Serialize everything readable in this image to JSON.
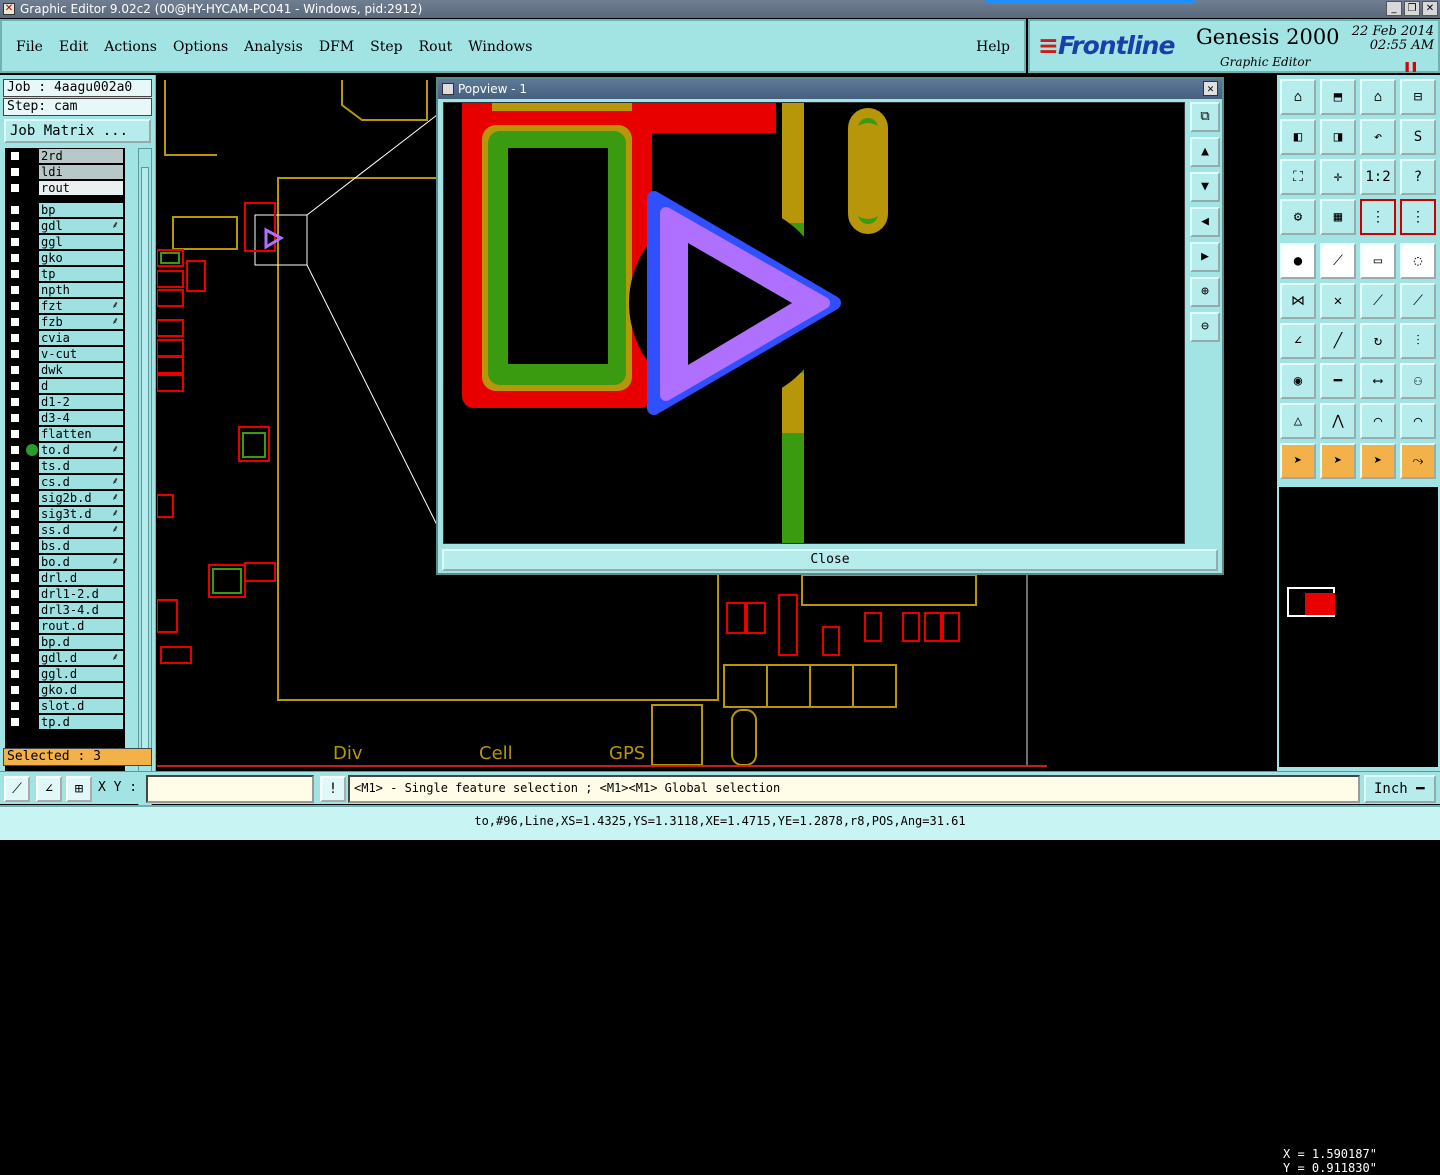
{
  "window": {
    "title": "Graphic Editor 9.02c2 (00@HY-HYCAM-PC041 - Windows, pid:2912)",
    "minimize": "_",
    "maximize": "❐",
    "close": "✕"
  },
  "menu": {
    "items": [
      "File",
      "Edit",
      "Actions",
      "Options",
      "Analysis",
      "DFM",
      "Step",
      "Rout",
      "Windows"
    ],
    "help": "Help"
  },
  "brand": {
    "logo": "Frontline",
    "product": "Genesis 2000",
    "subtitle": "Graphic Editor",
    "date": "22 Feb 2014",
    "time": "02:55 AM"
  },
  "left": {
    "job": "Job : 4aagu002a0",
    "step": "Step: cam",
    "job_matrix": "Job Matrix ...",
    "selected": "Selected : 3",
    "layers": [
      {
        "name": "2rd",
        "style": "gray"
      },
      {
        "name": "ldi",
        "style": "gray"
      },
      {
        "name": "rout",
        "style": "light"
      },
      {
        "name": "bp"
      },
      {
        "name": "gdl",
        "mark": true
      },
      {
        "name": "ggl"
      },
      {
        "name": "gko"
      },
      {
        "name": "tp"
      },
      {
        "name": "npth"
      },
      {
        "name": "fzt",
        "mark": true
      },
      {
        "name": "fzb",
        "mark": true
      },
      {
        "name": "cvia"
      },
      {
        "name": "v-cut"
      },
      {
        "name": "dwk"
      },
      {
        "name": "d"
      },
      {
        "name": "d1-2"
      },
      {
        "name": "d3-4"
      },
      {
        "name": "flatten"
      },
      {
        "name": "to.d",
        "mark": true,
        "active": true
      },
      {
        "name": "ts.d"
      },
      {
        "name": "cs.d",
        "mark": true
      },
      {
        "name": "sig2b.d",
        "mark": true
      },
      {
        "name": "sig3t.d",
        "mark": true
      },
      {
        "name": "ss.d",
        "mark": true
      },
      {
        "name": "bs.d"
      },
      {
        "name": "bo.d",
        "mark": true
      },
      {
        "name": "drl.d"
      },
      {
        "name": "drl1-2.d"
      },
      {
        "name": "drl3-4.d"
      },
      {
        "name": "rout.d"
      },
      {
        "name": "bp.d"
      },
      {
        "name": "gdl.d",
        "mark": true
      },
      {
        "name": "ggl.d"
      },
      {
        "name": "gko.d"
      },
      {
        "name": "slot.d"
      },
      {
        "name": "tp.d"
      }
    ]
  },
  "canvas": {
    "labels": [
      "Div",
      "Cell",
      "GPS"
    ]
  },
  "popview": {
    "title": "Popview - 1",
    "close_label": "Close"
  },
  "right": {
    "x": "X = 1.590187\"",
    "y": "Y = 0.911830\""
  },
  "bottom": {
    "xy_label": "X Y :",
    "xy_value": "",
    "message": "<M1> - Single feature selection ; <M1><M1> Global selection",
    "unit": "Inch",
    "status": "to,#96,Line,XS=1.4325,YS=1.3118,XE=1.4715,YE=1.2878,r8,POS,Ang=31.61"
  },
  "colors": {
    "panel": "#a2e4e4",
    "copper_outline_red": "#e80000",
    "copper_fill_green": "#3a9a10",
    "outline_gold": "#b8960a",
    "select_violet": "#b070ff",
    "highlight_orange": "#f3b14a"
  }
}
